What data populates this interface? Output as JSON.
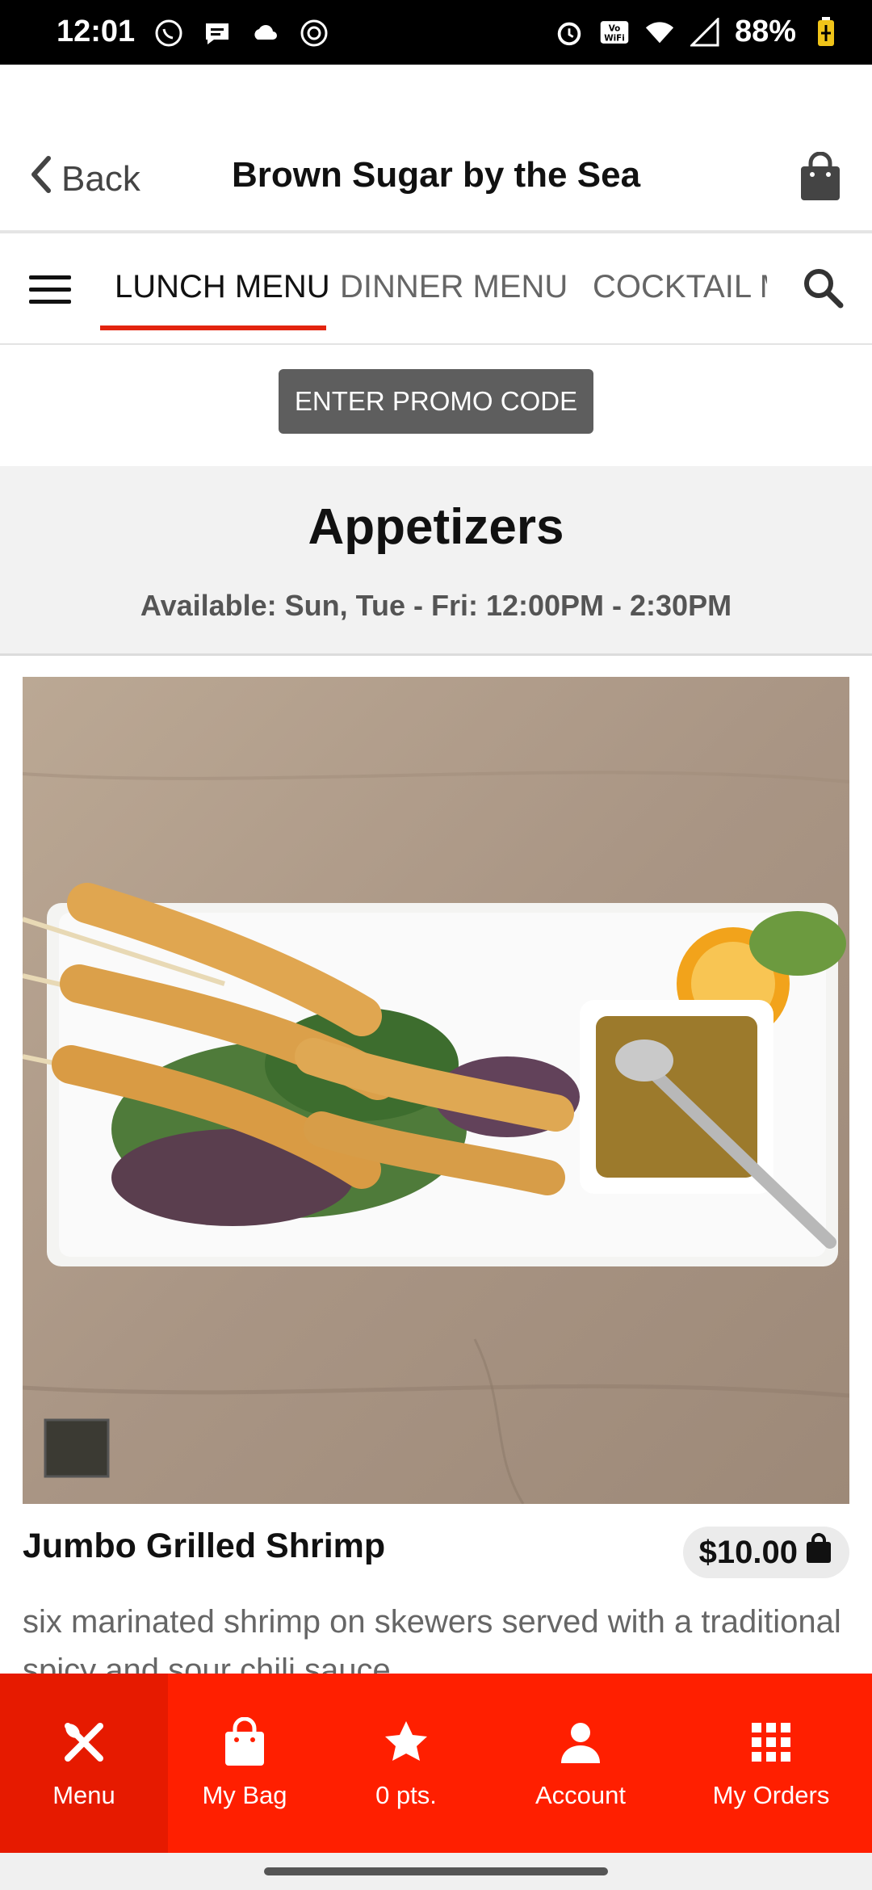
{
  "status_bar": {
    "time": "12:01",
    "battery": "88%"
  },
  "header": {
    "back_label": "Back",
    "title": "Brown Sugar by the Sea"
  },
  "tabs": [
    {
      "label": "LUNCH MENU"
    },
    {
      "label": "DINNER MENU"
    },
    {
      "label": "COCKTAIL ME"
    }
  ],
  "promo": {
    "label": "ENTER PROMO CODE"
  },
  "section": {
    "title": "Appetizers",
    "availability": "Available: Sun, Tue - Fri: 12:00PM - 2:30PM"
  },
  "item": {
    "name": "Jumbo Grilled Shrimp",
    "price": "$10.00",
    "description": "six marinated shrimp on skewers served with a traditional spicy and sour chili sauce."
  },
  "bottom_nav": [
    {
      "label": "Menu",
      "icon": "fork-knife-icon"
    },
    {
      "label": "My Bag",
      "icon": "bag-icon"
    },
    {
      "label": "0 pts.",
      "icon": "star-icon"
    },
    {
      "label": "Account",
      "icon": "person-icon"
    },
    {
      "label": "My Orders",
      "icon": "grid-icon"
    }
  ],
  "colors": {
    "accent": "#ff1f00",
    "active_tab_underline": "#e3240f",
    "promo_button": "#5e5e5e"
  }
}
